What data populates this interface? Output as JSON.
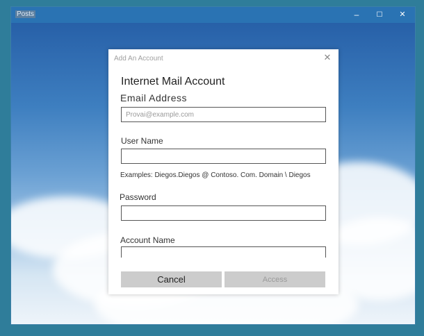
{
  "window": {
    "title": "Posts",
    "controls": {
      "minimize": "–",
      "maximize": "☐",
      "close": "✕"
    }
  },
  "dialog": {
    "title": "Add An Account",
    "close": "✕",
    "heading": "Internet Mail Account",
    "email": {
      "label": "Email Address",
      "placeholder": "Provai@example.com"
    },
    "username": {
      "label": "User Name",
      "value": "",
      "hint": "Examples: Diegos.Diegos @ Contoso. Com. Domain \\ Diegos"
    },
    "password": {
      "label": "Password",
      "value": ""
    },
    "account_name": {
      "label": "Account Name",
      "value": ""
    },
    "buttons": {
      "cancel": "Cancel",
      "access": "Access"
    }
  },
  "colors": {
    "titlebar": "#2a73b3",
    "button": "#cccccc"
  }
}
